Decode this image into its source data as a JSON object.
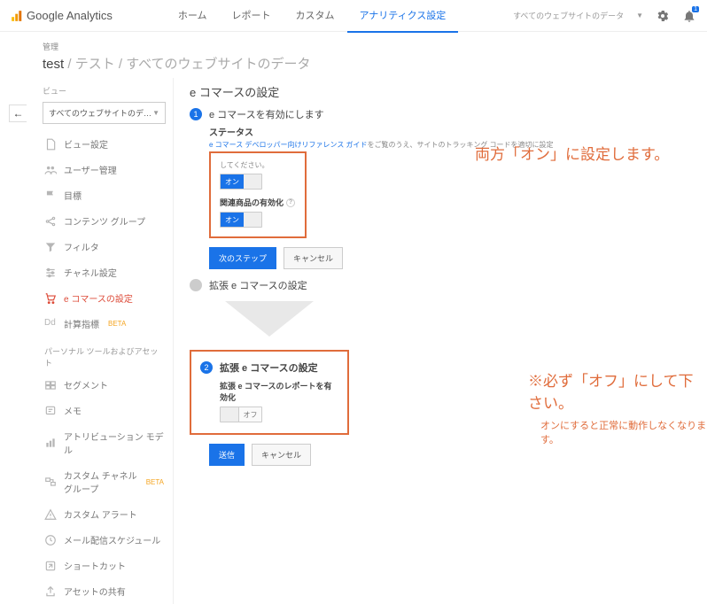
{
  "topbar": {
    "logo_text": "Google Analytics",
    "nav": [
      "ホーム",
      "レポート",
      "カスタム",
      "アナリティクス設定"
    ],
    "right_text": "すべてのウェブサイトのデータ",
    "bell_badge": "1"
  },
  "header": {
    "sub": "管理",
    "title_main": "test",
    "title_rest": " / テスト / すべてのウェブサイトのデータ"
  },
  "sidebar": {
    "section_label": "ビュー",
    "select_value": "すべてのウェブサイトのデ…",
    "items": [
      {
        "label": "ビュー設定",
        "icon": "file"
      },
      {
        "label": "ユーザー管理",
        "icon": "users"
      },
      {
        "label": "目標",
        "icon": "flag"
      },
      {
        "label": "コンテンツ グループ",
        "icon": "share"
      },
      {
        "label": "フィルタ",
        "icon": "funnel"
      },
      {
        "label": "チャネル設定",
        "icon": "sliders"
      },
      {
        "label": "e コマースの設定",
        "icon": "cart",
        "active": true
      },
      {
        "label": "計算指標 ",
        "icon": "dd",
        "beta": "BETA"
      }
    ],
    "section2": "パーソナル ツールおよびアセット",
    "items2": [
      {
        "label": "セグメント",
        "icon": "segment"
      },
      {
        "label": "メモ",
        "icon": "note"
      },
      {
        "label": "アトリビューション モデル",
        "icon": "bars"
      },
      {
        "label": "カスタム チャネル グループ",
        "icon": "channel",
        "beta": "BETA"
      },
      {
        "label": "カスタム アラート",
        "icon": "alert"
      },
      {
        "label": "メール配信スケジュール",
        "icon": "clock"
      },
      {
        "label": "ショートカット",
        "icon": "shortcut"
      },
      {
        "label": "アセットの共有",
        "icon": "share2"
      }
    ]
  },
  "main": {
    "title": "e コマースの設定",
    "step1": {
      "num": "1",
      "label": "e コマースを有効にします",
      "status_title": "ステータス",
      "status_desc1": "e コマース デベロッパー向けリファレンス ガイド",
      "status_desc2": "をご覧のうえ、サイトのトラッキング コードを適切に設定",
      "box_note": "してください。",
      "toggle_on": "オン",
      "related_label": "関連商品の有効化",
      "next_btn": "次のステップ",
      "cancel_btn": "キャンセル"
    },
    "step2_gray": {
      "num": "",
      "label": "拡張 e コマースの設定"
    },
    "step2": {
      "num": "2",
      "label": "拡張 e コマースの設定",
      "sub": "拡張 e コマースのレポートを有効化",
      "toggle_off": "オフ"
    },
    "submit_btn": "送信",
    "cancel_btn2": "キャンセル"
  },
  "annotations": {
    "a1": "両方「オン」に設定します。",
    "a2": "※必ず「オフ」にして下さい。",
    "a2_sub": "オンにすると正常に動作しなくなります。"
  }
}
